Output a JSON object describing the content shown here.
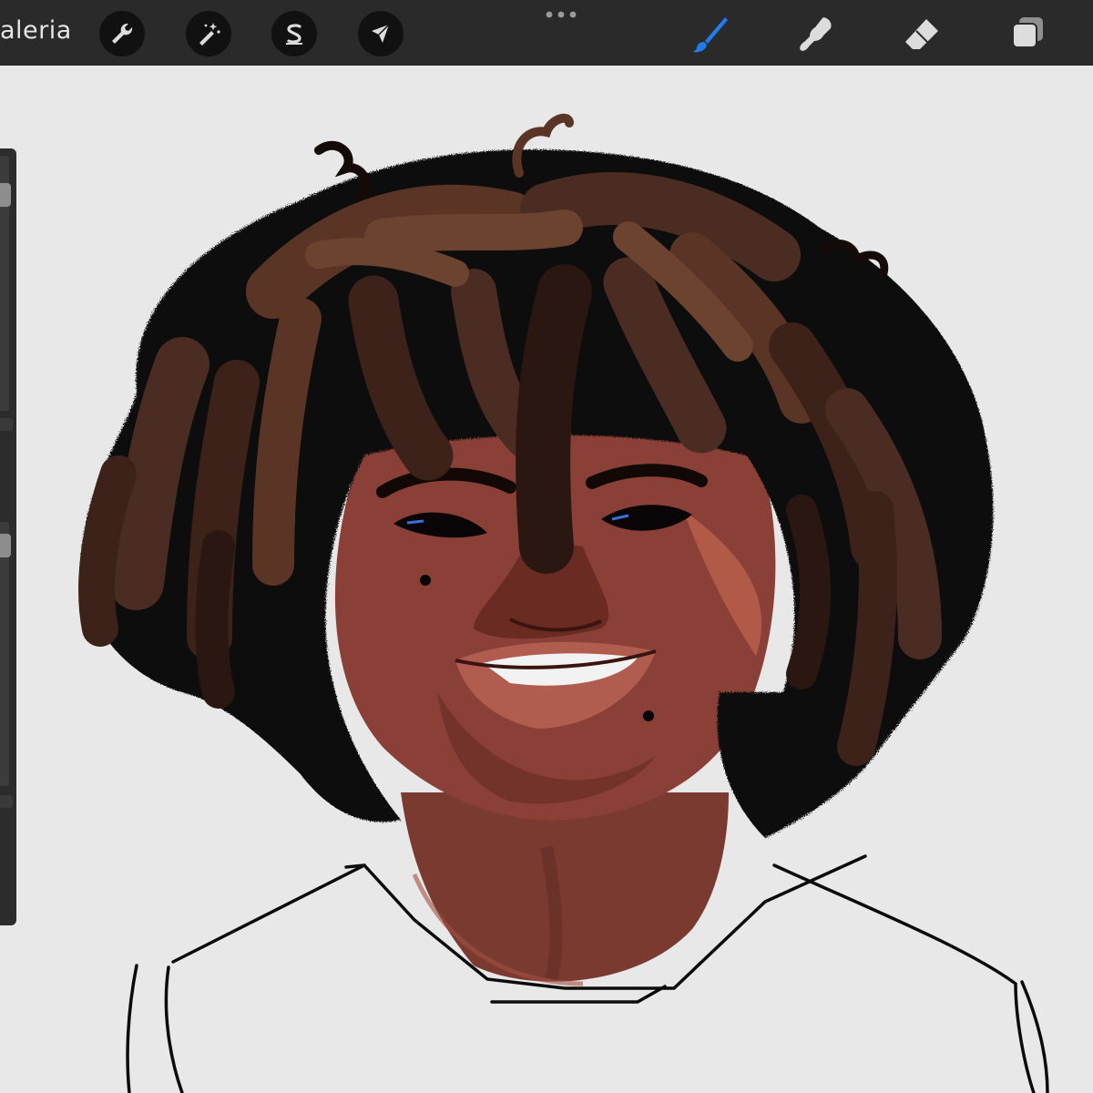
{
  "app": {
    "gallery_label": "aleria"
  },
  "toolbar": {
    "left_tools": [
      {
        "name": "wrench-icon",
        "action": "actions"
      },
      {
        "name": "magic-wand-icon",
        "action": "adjustments"
      },
      {
        "name": "selection-s-icon",
        "action": "selection"
      },
      {
        "name": "arrow-cursor-icon",
        "action": "transform"
      }
    ],
    "right_tools": [
      {
        "name": "brush-icon",
        "action": "paint",
        "active": true
      },
      {
        "name": "smudge-icon",
        "action": "smudge"
      },
      {
        "name": "eraser-icon",
        "action": "erase"
      },
      {
        "name": "layers-icon",
        "action": "layers"
      }
    ],
    "colors": {
      "bar": "#2a2a2a",
      "active_accent": "#1e7bf0",
      "icon": "#d9d9d9"
    }
  },
  "canvas": {
    "background": "#e9e8e9"
  },
  "sidebar": {
    "sliders": [
      "brush-size",
      "opacity"
    ]
  }
}
